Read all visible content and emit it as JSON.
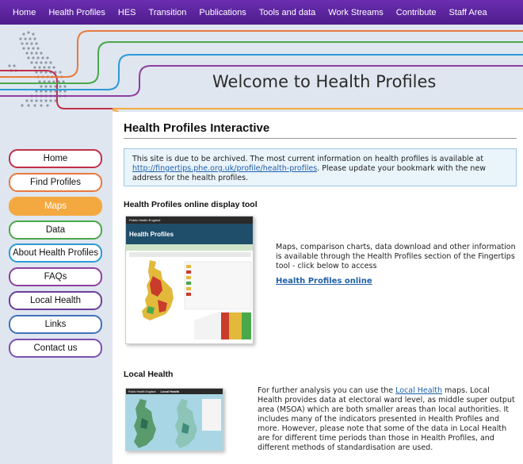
{
  "nav": {
    "items": [
      "Home",
      "Health Profiles",
      "HES",
      "Transition",
      "Publications",
      "Tools and data",
      "Work Streams",
      "Contribute",
      "Staff Area"
    ]
  },
  "banner": {
    "title": "Welcome to Health Profiles"
  },
  "sidebar": {
    "items": [
      {
        "label": "Home",
        "color": "#c0304a"
      },
      {
        "label": "Find Profiles",
        "color": "#e87a3e"
      },
      {
        "label": "Maps",
        "color": "#f4a940",
        "active": true
      },
      {
        "label": "Data",
        "color": "#4aa84a"
      },
      {
        "label": "About Health Profiles",
        "color": "#2c9ad6"
      },
      {
        "label": "FAQs",
        "color": "#8e3fa0"
      },
      {
        "label": "Local Health",
        "color": "#6c3f9a"
      },
      {
        "label": "Links",
        "color": "#3f72b8"
      },
      {
        "label": "Contact us",
        "color": "#7b4fb0"
      }
    ]
  },
  "main": {
    "title": "Health Profiles Interactive",
    "notice": {
      "before": "This site is due to be archived. The most current information on health profiles is available at ",
      "link": "http://fingertips.phe.org.uk/profile/health-profiles",
      "after": ". Please update your bookmark with the new address for the health profiles."
    },
    "display_tool": {
      "heading": "Health Profiles online display tool",
      "description": "Maps, comparison charts, data download and other information is available through the Health Profiles section of the Fingertips tool - click below to access",
      "link": "Health Profiles online",
      "thumb_header": "Public Health England",
      "thumb_title": "Health Profiles"
    },
    "local_health": {
      "heading": "Local Health",
      "before": "For further analysis you can use the ",
      "link": "Local Health",
      "after": " maps. Local Health provides data at electoral ward level, as middle super output area (MSOA) which are both smaller areas than local authorities. It includes many of the indicators presented in Health Profiles and more. However, please note that some of the data in Local Health are for different time periods than those in Health Profiles, and different methods of standardisation are used.",
      "thumb_header": "Public Health England",
      "thumb_title": "Local Health"
    }
  },
  "colors": {
    "nav_bg": "#5a22a0",
    "banner_bg": "#dfe6ef",
    "link": "#1f5fa8",
    "maps_active": "#f4a940"
  }
}
